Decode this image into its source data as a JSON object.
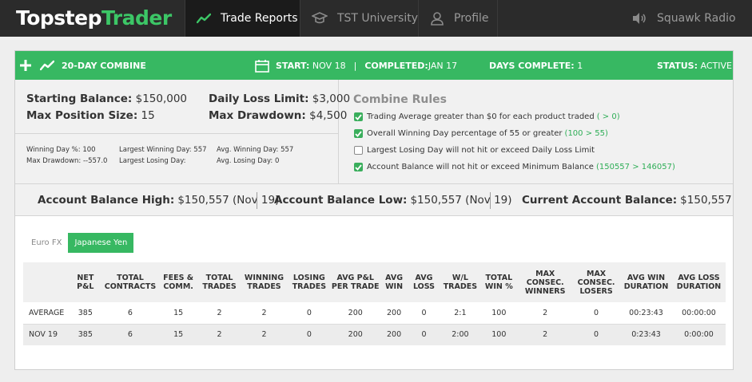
{
  "brand": {
    "part1": "Topstep",
    "part2": "Trader"
  },
  "nav": {
    "trade_reports": "Trade Reports",
    "tst_university": "TST University",
    "profile": "Profile",
    "squawk_radio": "Squawk Radio"
  },
  "combine": {
    "title": "20-DAY COMBINE",
    "start_label": "START:",
    "start_value": "NOV 18",
    "separator": "|",
    "completed_label": "COMPLETED:",
    "completed_value": "JAN 17",
    "days_label": "DAYS COMPLETE:",
    "days_value": "1",
    "status_label": "STATUS:",
    "status_value": "ACTIVE"
  },
  "summary": {
    "starting_balance_label": "Starting Balance:",
    "starting_balance": "$150,000",
    "daily_loss_limit_label": "Daily Loss Limit:",
    "daily_loss_limit": "$3,000",
    "max_position_label": "Max Position Size:",
    "max_position": "15",
    "max_drawdown_label": "Max Drawdown:",
    "max_drawdown": "$4,500"
  },
  "small_stats": {
    "winning_day_pct": "Winning Day %: 100",
    "max_drawdown": "Max Drawdown: --557.0",
    "largest_winning_day": "Largest Winning Day: 557",
    "largest_losing_day": "Largest Losing Day:",
    "avg_winning_day": "Avg. Winning Day: 557",
    "avg_losing_day": "Avg. Losing Day: 0"
  },
  "rules": {
    "title": "Combine Rules",
    "items": [
      {
        "text": "Trading Average greater than $0 for each product traded",
        "note": "( > 0)",
        "checked": true
      },
      {
        "text": "Overall Winning Day percentage of 55 or greater",
        "note": "(100 > 55)",
        "checked": true
      },
      {
        "text": "Largest Losing Day will not hit or exceed Daily Loss Limit",
        "note": "",
        "checked": false
      },
      {
        "text": "Account Balance will not hit or exceed Minimum Balance",
        "note": "(150557 > 146057)",
        "checked": true
      }
    ]
  },
  "balances": {
    "high_label": "Account Balance High:",
    "high_value": "$150,557 (Nov 19)",
    "low_label": "Account Balance Low:",
    "low_value": "$150,557 (Nov 19)",
    "current_label": "Current Account Balance:",
    "current_value": "$150,557"
  },
  "product_tabs": [
    "Euro FX",
    "Japanese Yen"
  ],
  "active_tab": "Japanese Yen",
  "table": {
    "headers": [
      "",
      "NET P&L",
      "TOTAL CONTRACTS",
      "FEES & COMM.",
      "TOTAL TRADES",
      "WINNING TRADES",
      "LOSING TRADES",
      "AVG P&L PER TRADE",
      "AVG WIN",
      "AVG LOSS",
      "W/L TRADES",
      "TOTAL WIN %",
      "MAX CONSEC. WINNERS",
      "MAX CONSEC. LOSERS",
      "AVG WIN DURATION",
      "AVG LOSS DURATION"
    ],
    "rows": [
      [
        "AVERAGE",
        "385",
        "6",
        "15",
        "2",
        "2",
        "0",
        "200",
        "200",
        "0",
        "2:1",
        "100",
        "2",
        "0",
        "00:23:43",
        "00:00:00"
      ],
      [
        "NOV 19",
        "385",
        "6",
        "15",
        "2",
        "2",
        "0",
        "200",
        "200",
        "0",
        "2:00",
        "100",
        "2",
        "0",
        "0:23:43",
        "0:00:00"
      ]
    ]
  },
  "colors": {
    "accent": "#37b862",
    "topbar": "#2b2b2b"
  }
}
